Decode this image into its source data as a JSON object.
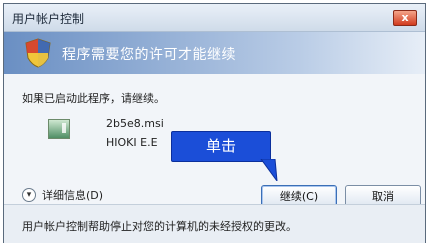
{
  "window": {
    "title": "用户帐户控制",
    "close_label": "x"
  },
  "banner": {
    "text": "程序需要您的许可才能继续",
    "icon": "uac-shield-icon"
  },
  "content": {
    "intro": "如果已启动此程序，请继续。",
    "file": {
      "icon": "msi-package-icon",
      "name": "2b5e8.msi",
      "publisher": "HIOKI E.E"
    },
    "callout": "单击"
  },
  "controls": {
    "details_label": "详细信息(D)",
    "details_icon": "chevron-down-icon",
    "continue_label": "继续(C)",
    "cancel_label": "取消"
  },
  "footer": {
    "text": "用户帐户控制帮助停止对您的计算机的未经授权的更改。"
  },
  "colors": {
    "banner_start": "#6a8fc3",
    "callout_blue": "#1b4ed8",
    "close_red": "#d13b1e"
  }
}
